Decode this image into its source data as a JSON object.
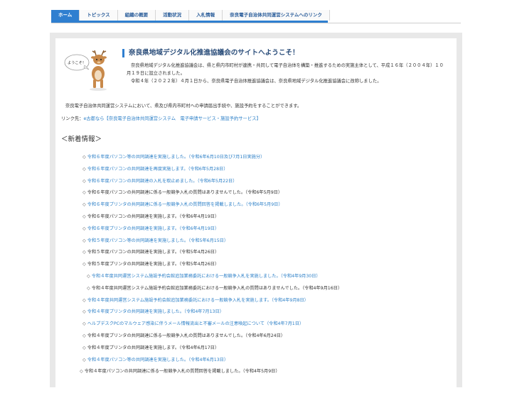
{
  "nav": {
    "items": [
      {
        "label": "ホーム",
        "active": true
      },
      {
        "label": "トピックス",
        "active": false
      },
      {
        "label": "組織の概要",
        "active": false
      },
      {
        "label": "活動状況",
        "active": false
      },
      {
        "label": "入札情報",
        "active": false
      },
      {
        "label": "奈良電子自治体共同運営システムへのリンク",
        "active": false
      }
    ]
  },
  "welcome": {
    "mascot_text": "ようこそ！",
    "title": "奈良県地域デジタル化推進協議会のサイトへようこそ！",
    "para1": "奈良県地域デジタル化推進協議会は、県と県内市町村が連携・共同して電子自治体を構築・推進するための実施主体として、平成１６年（２００４年）１０月１９日に設立されました。",
    "para2": "令和４年（２０２２年）４月１日から、奈良県電子自治体推進協議会は、奈良県地域デジタル化推進協議会に改称しました。"
  },
  "system_desc": "奈良電子自治体共同運営システムにおいて、県及び県内市町村への申請届出手続や、施設予約をすることができます。",
  "link_line": {
    "prefix": "リンク先：",
    "link_text": "e古都なら【奈良電子自治体共同運営システム　電子申請サービス・施設予約サービス】"
  },
  "news": {
    "heading": "＜新着情報＞",
    "marker": "◇",
    "items": [
      {
        "text": "令和６年度パソコン等の共同調達を実施しました。（令和6年6月10日及び7月1日実施分）",
        "link": true,
        "indent": 1
      },
      {
        "text": "令和６年度パソコンの共同調達を再度実施します。（令和6年5月28日）",
        "link": true,
        "indent": 1
      },
      {
        "text": "令和６年度パソコンの共同調達の入札を取止めました。（令和6年5月22日）",
        "link": true,
        "indent": 1
      },
      {
        "text": "令和６年度パソコンの共同調達に係る一般競争入札の質問はありませんでした。（令和6年5月9日）",
        "link": false,
        "indent": 1
      },
      {
        "text": "令和６年度プリンタの共同調達に係る一般競争入札の質問回答を掲載しました。（令和6年5月9日）",
        "link": true,
        "indent": 1
      },
      {
        "text": "令和６年度パソコンの共同調達を実施します。（令和6年4月19日）",
        "link": false,
        "indent": 1
      },
      {
        "text": "令和６年度プリンタの共同調達を実施します。（令和6年4月19日）",
        "link": true,
        "indent": 1
      },
      {
        "text": "令和５年度パソコン等の共同調達を実施しました。（令和5年6月15日）",
        "link": true,
        "indent": 1
      },
      {
        "text": "令和５年度パソコンの共同調達を実施します。（令和5年4月26日）",
        "link": false,
        "indent": 1
      },
      {
        "text": "令和５年度プリンタの共同調達を実施します。（令和5年4月26日）",
        "link": false,
        "indent": 1
      },
      {
        "text": "令和４年度共同運営システム施設予約会館追加業務委託における一般競争入札を実施しました。（令和4年9月30日）",
        "link": true,
        "indent": 2
      },
      {
        "text": "令和４年度共同運営システム施設予約会館追加業務委託における一般競争入札の質問はありませんでした。（令和4年9月16日）",
        "link": false,
        "indent": 2
      },
      {
        "text": "令和４年度共同運営システム施設予約会館追加業務委託における一般競争入札を実施します。（令和4年9月8日）",
        "link": true,
        "indent": 1
      },
      {
        "text": "令和４年度プリンタの共同調達を実施しました。（令和4年7月13日）",
        "link": true,
        "indent": 1
      },
      {
        "text": "ヘルプデスクPCのマルウェア感染に伴うメール情報流出と不審メールの注意喚起について（令和4年7月1日）",
        "link": true,
        "indent": 1
      },
      {
        "text": "令和４年度プリンタの共同調達に係る一般競争入札の質問はありませんでした。（令和4年6月24日）",
        "link": false,
        "indent": 1
      },
      {
        "text": "令和４年度プリンタの共同調達を実施します。（令和4年6月17日）",
        "link": false,
        "indent": 1
      },
      {
        "text": "令和４年度パソコン等の共同調達を実施しました。（令和4年6月13日）",
        "link": true,
        "indent": 1
      },
      {
        "text": "令和４年度パソコンの共同調達に係る一般競争入札の質問回答を掲載しました。（令和4年5月9日）",
        "link": false,
        "indent": 0
      }
    ]
  },
  "colors": {
    "accent": "#2f7fd0",
    "link": "#2b7fc7",
    "title": "#2a4d7a"
  }
}
